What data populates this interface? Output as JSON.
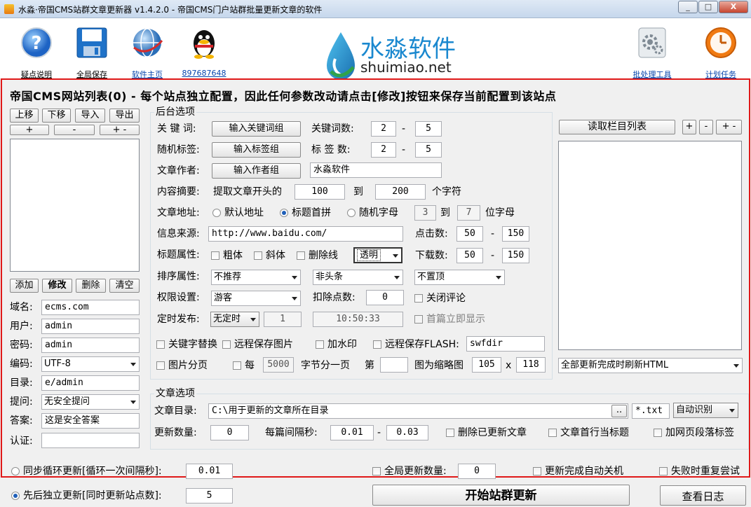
{
  "window": {
    "title": "水淼·帝国CMS站群文章更新器 v1.4.2.0 - 帝国CMS门户站群批量更新文章的软件",
    "min": "_",
    "max": "□",
    "close": "X"
  },
  "toolbar": {
    "items": [
      {
        "label": "疑点说明",
        "icon": "help-icon"
      },
      {
        "label": "全局保存",
        "icon": "save-icon"
      },
      {
        "label": "软件主页",
        "icon": "globe-icon"
      },
      {
        "label": "897687648",
        "icon": "qq-icon"
      },
      {
        "label": "批处理工具",
        "icon": "batch-tool-icon"
      },
      {
        "label": "计划任务",
        "icon": "clock-icon"
      }
    ],
    "logo_text": "水淼软件",
    "logo_url": "shuimiao.net"
  },
  "heading": "帝国CMS网站列表(0) - 每个站点独立配置，因此任何参数改动请点击[修改]按钮来保存当前配置到该站点",
  "left": {
    "btn_up": "上移",
    "btn_down": "下移",
    "btn_import": "导入",
    "btn_export": "导出",
    "btn_plus": "+",
    "btn_minus": "-",
    "btn_plusminus": "+ -",
    "btn_add": "添加",
    "btn_edit": "修改",
    "btn_delete": "删除",
    "btn_clear": "清空",
    "domain_label": "域名:",
    "domain_value": "ecms.com",
    "user_label": "用户:",
    "user_value": "admin",
    "pass_label": "密码:",
    "pass_value": "admin",
    "enc_label": "编码:",
    "enc_value": "UTF-8",
    "dir_label": "目录:",
    "dir_value": "e/admin",
    "q_label": "提问:",
    "q_value": "无安全提问",
    "a_label": "答案:",
    "a_value": "这是安全答案",
    "auth_label": "认证:",
    "auth_value": ""
  },
  "backend": {
    "title": "后台选项",
    "kw_label": "关 键 词:",
    "kw_btn": "输入关键词组",
    "kwcount_label": "关键词数:",
    "kwcount_min": "2",
    "kwcount_max": "5",
    "dash": "-",
    "tag_label": "随机标签:",
    "tag_btn": "输入标签组",
    "tagcount_label": "标 签 数:",
    "tagcount_min": "2",
    "tagcount_max": "5",
    "author_label": "文章作者:",
    "author_btn": "输入作者组",
    "author_value": "水淼软件",
    "summary_label": "内容摘要:",
    "summary_pre": "提取文章开头的",
    "summary_min": "100",
    "summary_to": "到",
    "summary_max": "200",
    "summary_suffix": "个字符",
    "url_label": "文章地址:",
    "url_opt1": "默认地址",
    "url_opt2": "标题首拼",
    "url_opt3": "随机字母",
    "url_min": "3",
    "url_to": "到",
    "url_max": "7",
    "url_suffix": "位字母",
    "source_label": "信息来源:",
    "source_value": "http://www.baidu.com/",
    "hits_label": "点击数:",
    "hits_min": "50",
    "hits_max": "150",
    "titleattr_label": "标题属性:",
    "bold": "粗体",
    "italic": "斜体",
    "strike": "删除线",
    "color_value": "透明",
    "downloads_label": "下载数:",
    "downloads_min": "50",
    "downloads_max": "150",
    "sort_label": "排序属性:",
    "sort_value": "不推荐",
    "headline_value": "非头条",
    "top_value": "不置顶",
    "perm_label": "权限设置:",
    "perm_value": "游客",
    "deduct_label": "扣除点数:",
    "deduct_value": "0",
    "close_comment": "关闭评论",
    "timed_label": "定时发布:",
    "timed_value": "无定时",
    "timed_num": "1",
    "timed_time": "10:50:33",
    "first_show": "首篇立即显示",
    "kw_replace": "关键字替换",
    "remote_img": "远程保存图片",
    "watermark": "加水印",
    "remote_flash": "远程保存FLASH:",
    "flash_dir": "swfdir",
    "paging": "图片分页",
    "every": "每",
    "every_value": "5000",
    "bytes_per_page": "字节分一页",
    "nth": "第",
    "nth_value": "",
    "thumb_label": "图为缩略图",
    "thumb_w": "105",
    "thumb_x": "x",
    "thumb_h": "118"
  },
  "column": {
    "read_btn": "读取栏目列表",
    "btn_plus": "+",
    "btn_minus": "-",
    "btn_plusminus": "+ -",
    "refresh_value": "全部更新完成时刷新HTML"
  },
  "article": {
    "title": "文章选项",
    "dir_label": "文章目录:",
    "dir_value": "C:\\用于更新的文章所在目录",
    "browse": "..",
    "ext": "*.txt",
    "encoding": "自动识别",
    "count_label": "更新数量:",
    "count_value": "0",
    "interval_label": "每篇间隔秒:",
    "interval_min": "0.01",
    "interval_dash": "-",
    "interval_max": "0.03",
    "del_updated": "删除已更新文章",
    "first_line_title": "文章首行当标题",
    "para_tags": "加网页段落标签"
  },
  "bottom": {
    "sync_loop": "同步循环更新[循环一次间隔秒]:",
    "sync_value": "0.01",
    "global_count": "全局更新数量:",
    "global_value": "0",
    "auto_shutdown": "更新完成自动关机",
    "retry": "失败时重复尝试",
    "seq_update": "先后独立更新[同时更新站点数]:",
    "seq_value": "5",
    "start": "开始站群更新",
    "log": "查看日志"
  }
}
